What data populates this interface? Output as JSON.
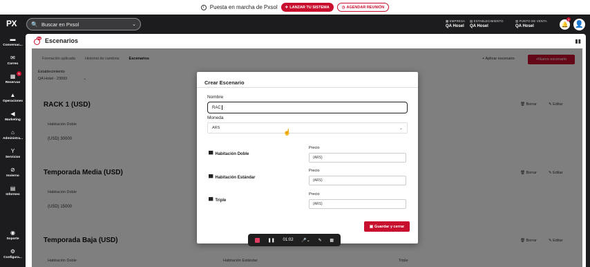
{
  "banner": {
    "text": "Puesta en marcha de Pxsol",
    "launch_label": "LANZAR TU SISTEMA",
    "meeting_label": "AGENDAR REUNIÓN"
  },
  "header": {
    "logo": "PX",
    "search_placeholder": "Buscar en Pxsol",
    "empresa_label": "EMPRESA",
    "empresa_value": "QA Hosel",
    "establecimiento_label": "ESTABLECIMIENTO",
    "establecimiento_value": "QA Hosel",
    "punto_label": "PUNTO DE VENTA",
    "punto_value": "QA Hosel",
    "notification_count": "3"
  },
  "sidebar": {
    "items": [
      {
        "label": "Conversac...",
        "icon": "chat-icon"
      },
      {
        "label": "Correo",
        "icon": "mail-icon"
      },
      {
        "label": "Reservas",
        "icon": "calendar-icon",
        "badge": "5"
      },
      {
        "label": "Operaciones",
        "icon": "operations-icon"
      },
      {
        "label": "Marketing",
        "icon": "megaphone-icon"
      },
      {
        "label": "Administra...",
        "icon": "bank-icon"
      },
      {
        "label": "Servicios",
        "icon": "cocktail-icon"
      },
      {
        "label": "Invierno",
        "icon": "block-icon"
      },
      {
        "label": "Informes",
        "icon": "report-icon"
      },
      {
        "label": "Soporte",
        "icon": "support-icon"
      },
      {
        "label": "Configura...",
        "icon": "gear-icon"
      }
    ]
  },
  "page": {
    "title": "Escenarios",
    "title_badge": "PX"
  },
  "background": {
    "tabs": [
      "Formación aplicada",
      "Historial de cambios",
      "Escenarios"
    ],
    "apply_label": "Aplicar escenario",
    "new_label": "Nuevo escenario",
    "establecimiento_label": "Establecimiento",
    "establecimiento_value": "QA Hotel - 23093",
    "sections": [
      {
        "title": "RACK 1 (USD)",
        "sub": "Habitación Doble",
        "value": "(USD) 30000"
      },
      {
        "title": "Temporada Media (USD)",
        "sub": "Habitación Doble",
        "value": "(USD) 15000"
      },
      {
        "title": "Temporada Baja (USD)",
        "sub": "Habitación Doble",
        "sub2": "Habitación Estándar",
        "sub3": "Triple"
      }
    ],
    "delete_label": "Borrar",
    "edit_label": "Editar"
  },
  "modal": {
    "title": "Crear Escenario",
    "name_label": "Nombre",
    "name_value": "RAC",
    "currency_label": "Moneda",
    "currency_value": "ARS",
    "price_label": "Precio",
    "rooms": [
      {
        "name": "Habitación Doble",
        "price_placeholder": "(ARS)"
      },
      {
        "name": "Habitación Estándar",
        "price_placeholder": "(ARS)"
      },
      {
        "name": "Triple",
        "price_placeholder": "(ARS)"
      }
    ],
    "save_label": "Guardar y cerrar"
  },
  "recorder": {
    "time": "01:02"
  }
}
